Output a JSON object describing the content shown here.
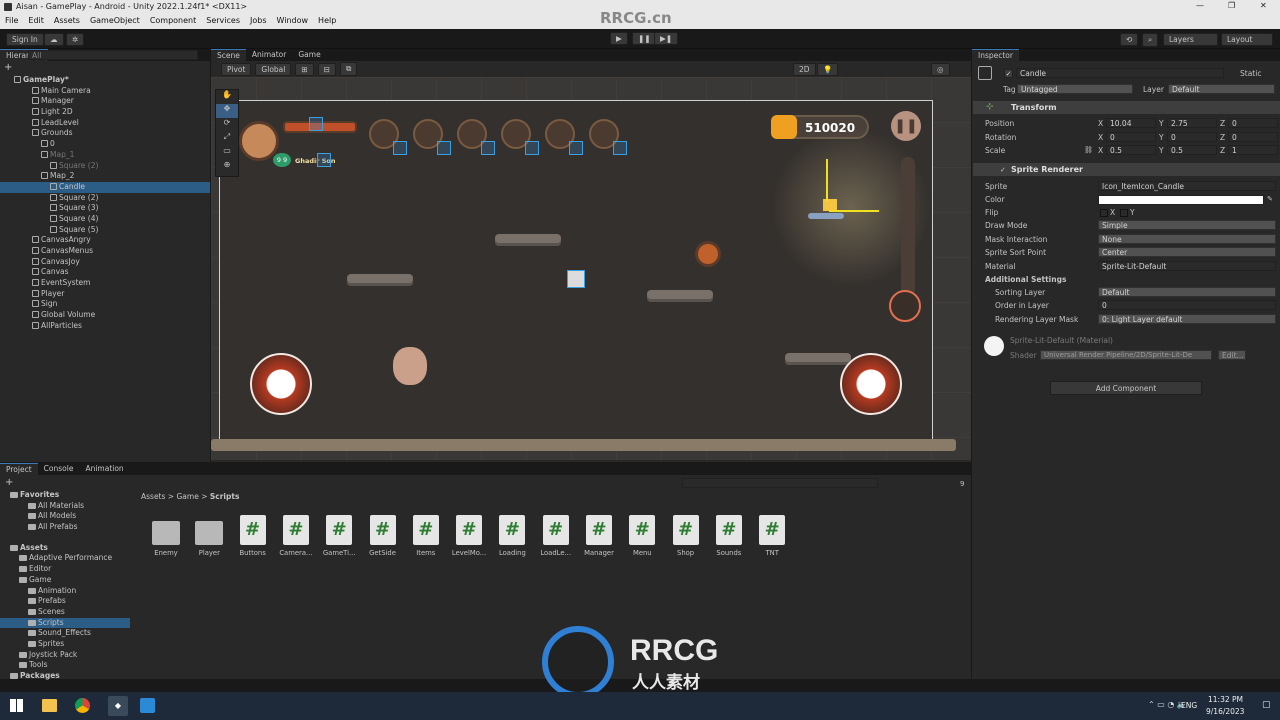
{
  "window": {
    "title": "Aisan - GamePlay - Android - Unity 2022.1.24f1* <DX11>"
  },
  "menu": [
    "File",
    "Edit",
    "Assets",
    "GameObject",
    "Component",
    "Services",
    "Jobs",
    "Window",
    "Help"
  ],
  "toolbar": {
    "signin": "Sign In",
    "layers": "Layers",
    "layout": "Layout"
  },
  "hierarchy": {
    "tab": "Hierarchy",
    "search_placeholder": "All",
    "items": [
      {
        "label": "GamePlay*",
        "indent": 0
      },
      {
        "label": "Main Camera",
        "indent": 2
      },
      {
        "label": "Manager",
        "indent": 2
      },
      {
        "label": "Light 2D",
        "indent": 2
      },
      {
        "label": "LeadLevel",
        "indent": 2
      },
      {
        "label": "Grounds",
        "indent": 2
      },
      {
        "label": "0",
        "indent": 3
      },
      {
        "label": "Map_1",
        "indent": 3
      },
      {
        "label": "Square (2)",
        "indent": 4
      },
      {
        "label": "Map_2",
        "indent": 3
      },
      {
        "label": "Candle",
        "indent": 4
      },
      {
        "label": "Square (2)",
        "indent": 4
      },
      {
        "label": "Square (3)",
        "indent": 4
      },
      {
        "label": "Square (4)",
        "indent": 4
      },
      {
        "label": "Square (5)",
        "indent": 4
      },
      {
        "label": "CanvasAngry",
        "indent": 2
      },
      {
        "label": "CanvasMenus",
        "indent": 2
      },
      {
        "label": "CanvasJoy",
        "indent": 2
      },
      {
        "label": "Canvas",
        "indent": 2
      },
      {
        "label": "EventSystem",
        "indent": 2
      },
      {
        "label": "Player",
        "indent": 2
      },
      {
        "label": "Sign",
        "indent": 2
      },
      {
        "label": "Global Volume",
        "indent": 2
      },
      {
        "label": "AllParticles",
        "indent": 2
      }
    ]
  },
  "scene": {
    "tabs": [
      "Scene",
      "Animator",
      "Game"
    ],
    "pivot": "Pivot",
    "global": "Global",
    "mode_2d": "2D",
    "hud": {
      "coins": "510020",
      "player_name": "Ghadir Son",
      "level": "9 9"
    }
  },
  "inspector": {
    "tab": "Inspector",
    "object_name": "Candle",
    "static_label": "Static",
    "tag_label": "Tag",
    "tag_value": "Untagged",
    "layer_label": "Layer",
    "layer_value": "Default",
    "transform": {
      "title": "Transform",
      "position_label": "Position",
      "pos_x": "10.04",
      "pos_y": "2.75",
      "pos_z": "0",
      "rotation_label": "Rotation",
      "rot_x": "0",
      "rot_y": "0",
      "rot_z": "0",
      "scale_label": "Scale",
      "scl_x": "0.5",
      "scl_y": "0.5",
      "scl_z": "1"
    },
    "sprite_renderer": {
      "title": "Sprite Renderer",
      "sprite_label": "Sprite",
      "sprite_value": "Icon_ItemIcon_Candle",
      "color_label": "Color",
      "flip_label": "Flip",
      "flip_x": "X",
      "flip_y": "Y",
      "draw_mode_label": "Draw Mode",
      "draw_mode_value": "Simple",
      "mask_label": "Mask Interaction",
      "mask_value": "None",
      "sort_point_label": "Sprite Sort Point",
      "sort_point_value": "Center",
      "material_label": "Material",
      "material_value": "Sprite-Lit-Default",
      "additional": "Additional Settings",
      "sorting_layer_label": "Sorting Layer",
      "sorting_layer_value": "Default",
      "order_label": "Order in Layer",
      "order_value": "0",
      "render_mask_label": "Rendering Layer Mask",
      "render_mask_value": "0: Light Layer default"
    },
    "material": {
      "name": "Sprite-Lit-Default (Material)",
      "shader_label": "Shader",
      "shader_value": "Universal Render Pipeline/2D/Sprite-Lit-De",
      "edit": "Edit..."
    },
    "add_component": "Add Component"
  },
  "project": {
    "tabs": [
      "Project",
      "Console",
      "Animation"
    ],
    "breadcrumb": [
      "Assets",
      "Game",
      "Scripts"
    ],
    "favorites_label": "Favorites",
    "favorites": [
      "All Materials",
      "All Models",
      "All Prefabs"
    ],
    "assets_label": "Assets",
    "tree": [
      {
        "label": "Adaptive Performance",
        "indent": 1
      },
      {
        "label": "Editor",
        "indent": 1
      },
      {
        "label": "Game",
        "indent": 1
      },
      {
        "label": "Animation",
        "indent": 2
      },
      {
        "label": "Prefabs",
        "indent": 2
      },
      {
        "label": "Scenes",
        "indent": 2
      },
      {
        "label": "Scripts",
        "indent": 2
      },
      {
        "label": "Sound_Effects",
        "indent": 2
      },
      {
        "label": "Sprites",
        "indent": 2
      },
      {
        "label": "Joystick Pack",
        "indent": 1
      },
      {
        "label": "Tools",
        "indent": 1
      },
      {
        "label": "Packages",
        "indent": 0
      }
    ],
    "count": "9",
    "assets": [
      {
        "name": "Enemy",
        "type": "folder"
      },
      {
        "name": "Player",
        "type": "folder"
      },
      {
        "name": "Buttons",
        "type": "script"
      },
      {
        "name": "Camera...",
        "type": "script"
      },
      {
        "name": "GameTi...",
        "type": "script"
      },
      {
        "name": "GetSide",
        "type": "script"
      },
      {
        "name": "Items",
        "type": "script"
      },
      {
        "name": "LevelMo...",
        "type": "script"
      },
      {
        "name": "Loading",
        "type": "script"
      },
      {
        "name": "LoadLe...",
        "type": "script"
      },
      {
        "name": "Manager",
        "type": "script"
      },
      {
        "name": "Menu",
        "type": "script"
      },
      {
        "name": "Shop",
        "type": "script"
      },
      {
        "name": "Sounds",
        "type": "script"
      },
      {
        "name": "TNT",
        "type": "script"
      }
    ]
  },
  "watermark": {
    "brand": "RRCG",
    "sub": "人人素材",
    "site": "RRCG.cn"
  },
  "taskbar": {
    "lang": "ENG",
    "time": "11:32 PM",
    "date": "9/16/2023"
  }
}
